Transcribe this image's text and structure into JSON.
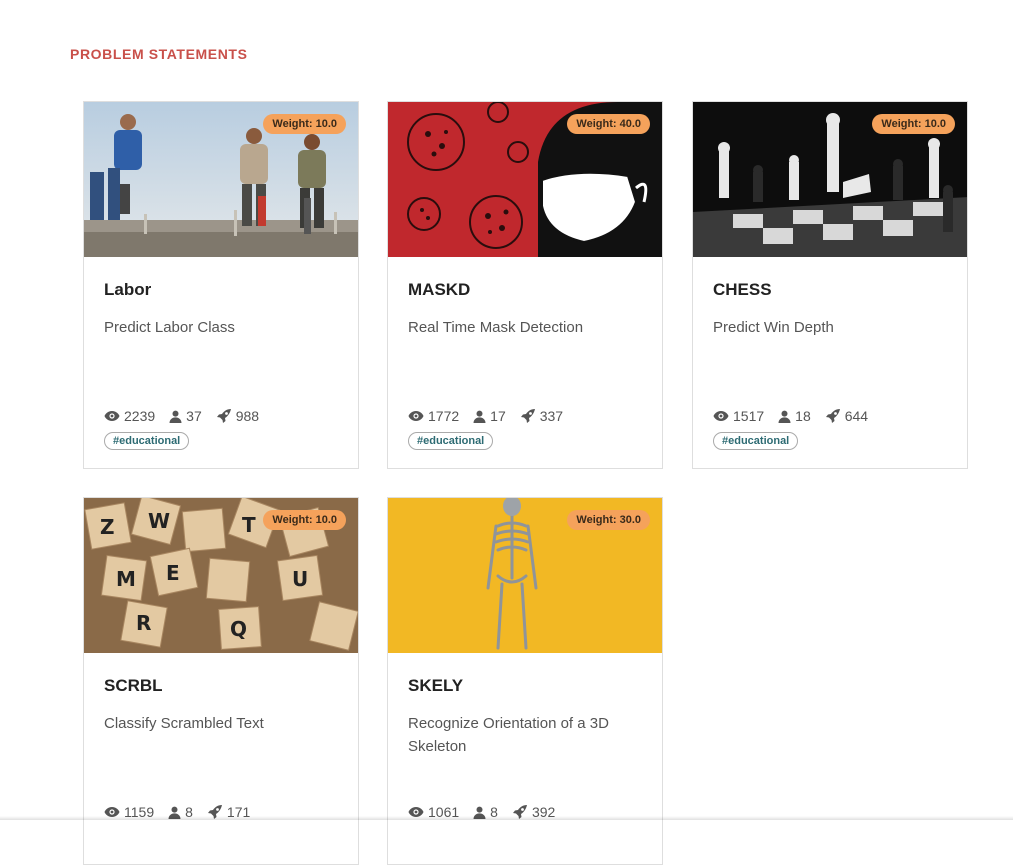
{
  "section": {
    "title": "PROBLEM STATEMENTS"
  },
  "cards": [
    {
      "title": "Labor",
      "description": "Predict Labor Class",
      "weight": "Weight: 10.0",
      "views": "2239",
      "participants": "37",
      "submissions": "988",
      "tag": "#educational",
      "image": "construction-workers-jackhammer-photo"
    },
    {
      "title": "MASKD",
      "description": "Real Time Mask Detection",
      "weight": "Weight: 40.0",
      "views": "1772",
      "participants": "17",
      "submissions": "337",
      "tag": "#educational",
      "image": "virus-face-mask-illustration"
    },
    {
      "title": "CHESS",
      "description": "Predict Win Depth",
      "weight": "Weight: 10.0",
      "views": "1517",
      "participants": "18",
      "submissions": "644",
      "tag": "#educational",
      "image": "chess-pieces-board-photo"
    },
    {
      "title": "SCRBL",
      "description": "Classify Scrambled Text",
      "weight": "Weight: 10.0",
      "views": "1159",
      "participants": "8",
      "submissions": "171",
      "image": "scrabble-tiles-photo"
    },
    {
      "title": "SKELY",
      "description": "Recognize Orientation of a 3D Skeleton",
      "weight": "Weight: 30.0",
      "views": "1061",
      "participants": "8",
      "submissions": "392",
      "image": "skeleton-on-yellow-photo"
    }
  ],
  "colors": {
    "accent": "#c9504a",
    "weight_badge": "#f5a25b",
    "tag_text": "#2d6b73",
    "mask_red": "#c0282d",
    "skely_yellow": "#f2b824"
  },
  "icons": {
    "views": "eye-icon",
    "participants": "user-icon",
    "submissions": "rocket-icon"
  }
}
